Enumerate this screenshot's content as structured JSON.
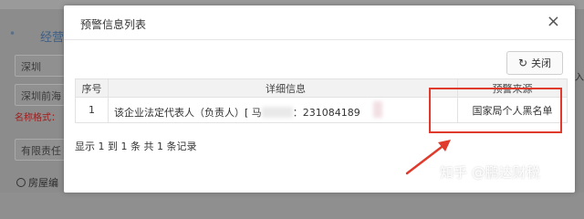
{
  "background": {
    "title": "经营",
    "fields": [
      "深圳",
      "深圳前海",
      "有限责任"
    ],
    "hint": "名称格式：",
    "radio_label": "房屋编",
    "side_text": "入"
  },
  "modal": {
    "title": "预警信息列表",
    "close_glyph": "×",
    "close_button_label": "关闭",
    "refresh_icon_glyph": "↻",
    "columns": [
      "序号",
      "详细信息",
      "预警来源"
    ],
    "rows": [
      {
        "no": "1",
        "detail_prefix": "该企业法定代表人（负责人）[ 马",
        "detail_mid": "：231084189",
        "source": "国家局个人黑名单"
      }
    ],
    "footer": "显示 1 到 1 条 共 1 条记录"
  },
  "colors": {
    "highlight": "#e03a2c",
    "arrow": "#e03a2c"
  },
  "watermark": "知乎 @鹏达财税"
}
